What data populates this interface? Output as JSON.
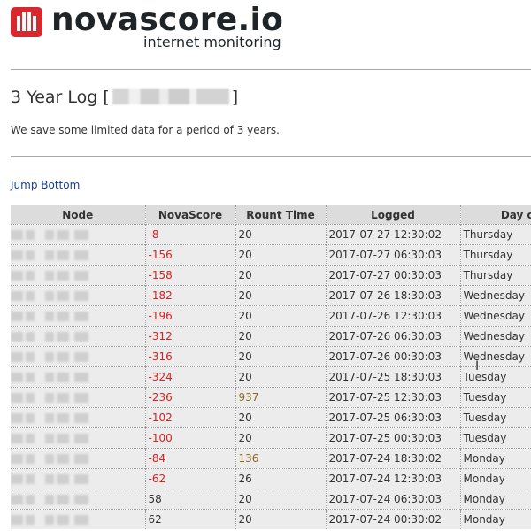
{
  "brand": {
    "name": "novascore.io",
    "tagline": "internet monitoring",
    "icon": "novascore-logo-icon"
  },
  "page": {
    "title": "3 Year Log [",
    "title_close": "]",
    "intro": "We save some limited data for a period of 3 years.",
    "jump_link": "Jump Bottom"
  },
  "table": {
    "columns": [
      "Node",
      "NovaScore",
      "Rount Time",
      "Logged",
      "Day of"
    ],
    "rows": [
      {
        "score": "-8",
        "round": "20",
        "logged": "2017-07-27 12:30:02",
        "day": "Thursday"
      },
      {
        "score": "-156",
        "round": "20",
        "logged": "2017-07-27 06:30:03",
        "day": "Thursday"
      },
      {
        "score": "-158",
        "round": "20",
        "logged": "2017-07-27 00:30:03",
        "day": "Thursday"
      },
      {
        "score": "-182",
        "round": "20",
        "logged": "2017-07-26 18:30:03",
        "day": "Wednesday"
      },
      {
        "score": "-196",
        "round": "20",
        "logged": "2017-07-26 12:30:03",
        "day": "Wednesday"
      },
      {
        "score": "-312",
        "round": "20",
        "logged": "2017-07-26 06:30:03",
        "day": "Wednesday"
      },
      {
        "score": "-316",
        "round": "20",
        "logged": "2017-07-26 00:30:03",
        "day": "Wednesday"
      },
      {
        "score": "-324",
        "round": "20",
        "logged": "2017-07-25 18:30:03",
        "day": "Tuesday"
      },
      {
        "score": "-236",
        "round": "937",
        "logged": "2017-07-25 12:30:03",
        "day": "Tuesday"
      },
      {
        "score": "-102",
        "round": "20",
        "logged": "2017-07-25 06:30:03",
        "day": "Tuesday"
      },
      {
        "score": "-100",
        "round": "20",
        "logged": "2017-07-25 00:30:03",
        "day": "Tuesday"
      },
      {
        "score": "-84",
        "round": "136",
        "logged": "2017-07-24 18:30:02",
        "day": "Monday"
      },
      {
        "score": "-62",
        "round": "26",
        "logged": "2017-07-24 12:30:03",
        "day": "Monday"
      },
      {
        "score": "58",
        "round": "20",
        "logged": "2017-07-24 06:30:03",
        "day": "Monday"
      },
      {
        "score": "62",
        "round": "20",
        "logged": "2017-07-24 00:30:02",
        "day": "Monday"
      }
    ]
  },
  "colors": {
    "negative_score": "#d92020",
    "positive_score": "#333333",
    "slow_round": "#8a6a20",
    "link": "#1a3d8f",
    "logo_red": "#d7282f"
  }
}
